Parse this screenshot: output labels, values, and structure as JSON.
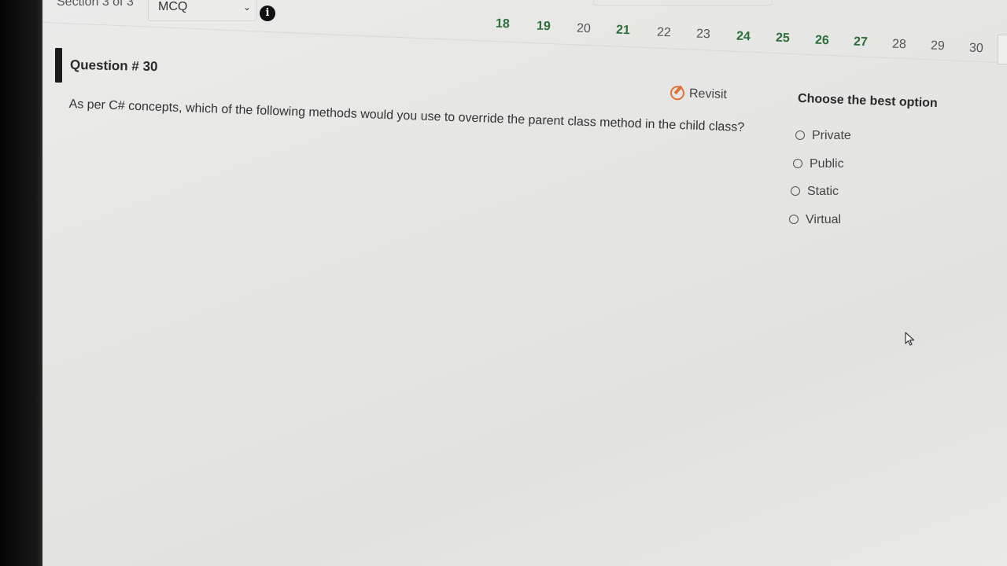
{
  "header": {
    "section_label": "Section 3 of 3",
    "section_type": "MCQ",
    "info_icon_glyph": "i"
  },
  "question_nav": {
    "numbers": [
      {
        "label": "18",
        "answered": true
      },
      {
        "label": "19",
        "answered": true
      },
      {
        "label": "20",
        "answered": false
      },
      {
        "label": "21",
        "answered": true
      },
      {
        "label": "22",
        "answered": false
      },
      {
        "label": "23",
        "answered": false
      },
      {
        "label": "24",
        "answered": true
      },
      {
        "label": "25",
        "answered": true
      },
      {
        "label": "26",
        "answered": true
      },
      {
        "label": "27",
        "answered": true
      },
      {
        "label": "28",
        "answered": false
      },
      {
        "label": "29",
        "answered": false
      },
      {
        "label": "30",
        "answered": false
      }
    ],
    "answered_color": "#2d6e3a",
    "current": "30"
  },
  "question": {
    "title": "Question # 30",
    "text": "As per C# concepts, which of the following methods would you use to override the parent class method in the child class?",
    "revisit_label": "Revisit"
  },
  "answers": {
    "heading": "Choose the best option",
    "options": [
      "Private",
      "Public",
      "Static",
      "Virtual"
    ]
  },
  "colors": {
    "revisit_accent": "#e0703a"
  }
}
